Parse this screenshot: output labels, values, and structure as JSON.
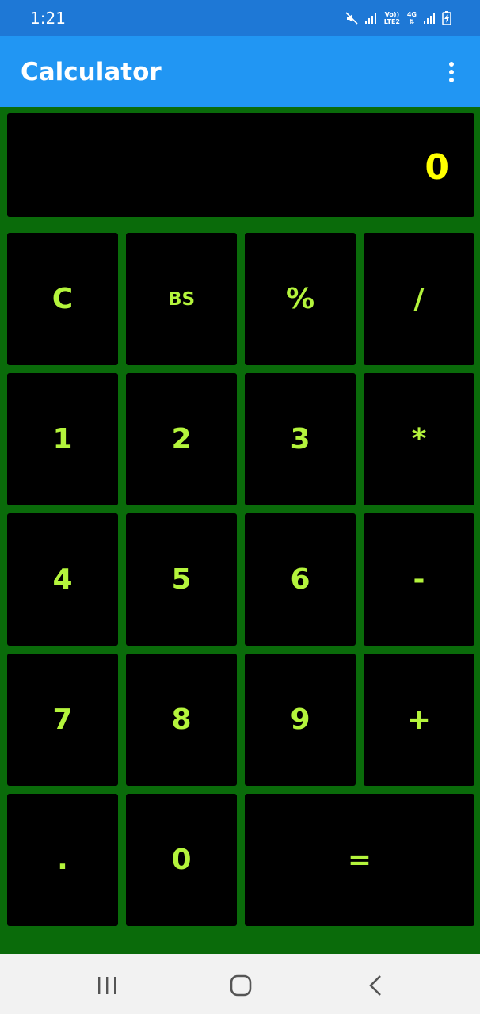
{
  "status_bar": {
    "time": "1:21",
    "network_line1": "Vo)) LTE2",
    "network_line2": "4G",
    "icons": [
      "mute-icon",
      "signal-icon",
      "signal-icon",
      "battery-icon"
    ]
  },
  "app_bar": {
    "title": "Calculator",
    "menu_icon": "more-vert-icon"
  },
  "display": {
    "value": "0"
  },
  "keypad": {
    "rows": [
      [
        "C",
        "BS",
        "%",
        "/"
      ],
      [
        "1",
        "2",
        "3",
        "*"
      ],
      [
        "4",
        "5",
        "6",
        "-"
      ],
      [
        "7",
        "8",
        "9",
        "+"
      ],
      [
        ".",
        "0",
        "="
      ]
    ]
  },
  "nav_bar": {
    "icons": [
      "recent-apps-icon",
      "home-icon",
      "back-icon"
    ]
  },
  "colors": {
    "status_bar": "#1e78d6",
    "app_bar": "#2196f3",
    "background": "#0a6b0a",
    "key_bg": "#000000",
    "key_text": "#b4f43c",
    "display_text": "#ffff00"
  }
}
